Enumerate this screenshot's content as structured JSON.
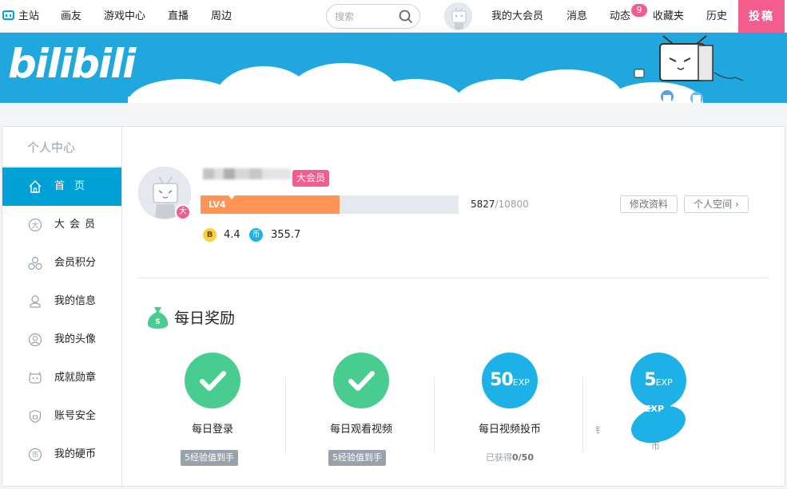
{
  "topnav": {
    "home": "主站",
    "items": [
      "画友",
      "游戏中心",
      "直播",
      "周边"
    ],
    "search_placeholder": "搜索",
    "right_items": [
      "我的大会员",
      "消息",
      "动态",
      "收藏夹",
      "历史"
    ],
    "dynamic_badge": "9",
    "upload": "投稿"
  },
  "sidebar": {
    "title": "个人中心",
    "items": [
      {
        "label": "首页",
        "icon": "home-icon"
      },
      {
        "label": "大会员",
        "icon": "vip-icon"
      },
      {
        "label": "会员积分",
        "icon": "points-icon"
      },
      {
        "label": "我的信息",
        "icon": "user-info-icon"
      },
      {
        "label": "我的头像",
        "icon": "avatar-icon"
      },
      {
        "label": "成就勋章",
        "icon": "medal-icon"
      },
      {
        "label": "账号安全",
        "icon": "shield-icon"
      },
      {
        "label": "我的硬币",
        "icon": "coin-icon"
      }
    ]
  },
  "profile": {
    "vip_tag": "大会员",
    "vip_dot": "大",
    "level": "LV4",
    "exp_current": "5827",
    "exp_total": "/10800",
    "level_progress": 0.5395,
    "edit_button": "修改资料",
    "space_button": "个人空间",
    "bcoin_icon": "B",
    "bcoin": "4.4",
    "coin_icon": "币",
    "coins": "355.7"
  },
  "rewards": {
    "title": "每日奖励",
    "tasks": [
      {
        "label": "每日登录",
        "tag": "5经验值到手",
        "status": "done"
      },
      {
        "label": "每日观看视频",
        "tag": "5经验值到手",
        "status": "done"
      },
      {
        "label": "每日视频投币",
        "exp_num": "50",
        "exp_unit": "EXP",
        "sub_prefix": "已获得",
        "sub_value": "0/50",
        "status": "pending"
      },
      {
        "exp_num": "5",
        "exp_unit": "EXP",
        "ghost_unit": "EXP",
        "ghost_char_left": "钅",
        "ghost_char_bottom": "币",
        "status": "pending"
      }
    ]
  },
  "colors": {
    "brand_blue": "#00a1d6",
    "pink": "#f25d8e",
    "level_orange": "#ff9455",
    "done_green": "#49cc90",
    "exp_blue": "#1eb1e7"
  }
}
